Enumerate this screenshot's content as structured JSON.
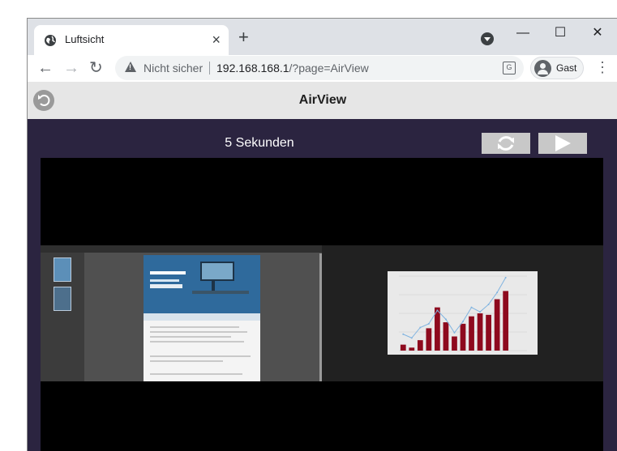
{
  "browser": {
    "tab_title": "Luftsicht",
    "tab_close": "×",
    "new_tab": "+",
    "window_controls": {
      "minimize": "—",
      "maximize": "☐",
      "close": "✕"
    },
    "nav": {
      "back": "←",
      "forward": "→",
      "reload": "↻"
    },
    "security_label": "Nicht sicher",
    "url_host": "192.168.168.1",
    "url_path": "/?page=AirView",
    "profile_label": "Gast",
    "menu_icon": "⋮",
    "icons": [
      "globe-icon",
      "tab-search-icon",
      "warning-icon",
      "translate-icon",
      "avatar-icon"
    ]
  },
  "app": {
    "title": "AirView",
    "timer_label": "5 Sekunden",
    "buttons": {
      "refresh": "refresh-icon",
      "play": "play-icon"
    },
    "colors": {
      "background": "#2b2440",
      "header": "#e6e6e6",
      "viewer": "#000000"
    }
  },
  "preview": {
    "left_panel": "pdf-document-preview",
    "right_panel": "bar-line-chart-preview",
    "chart_data": {
      "type": "bar",
      "categories": [
        "1",
        "2",
        "3",
        "4",
        "5",
        "6",
        "7",
        "8",
        "9",
        "10",
        "11",
        "12",
        "13",
        "14",
        "15"
      ],
      "series": [
        {
          "type": "bar",
          "values": [
            8,
            4,
            14,
            30,
            58,
            38,
            19,
            36,
            46,
            50,
            48,
            69,
            80,
            0,
            0
          ]
        },
        {
          "type": "line",
          "values": [
            22,
            17,
            31,
            36,
            54,
            42,
            24,
            39,
            58,
            52,
            62,
            78,
            98,
            0,
            0
          ]
        }
      ],
      "ylim": [
        0,
        100
      ],
      "colors": {
        "bar": "#8e0a1e",
        "line": "#7fb3e0"
      }
    }
  }
}
